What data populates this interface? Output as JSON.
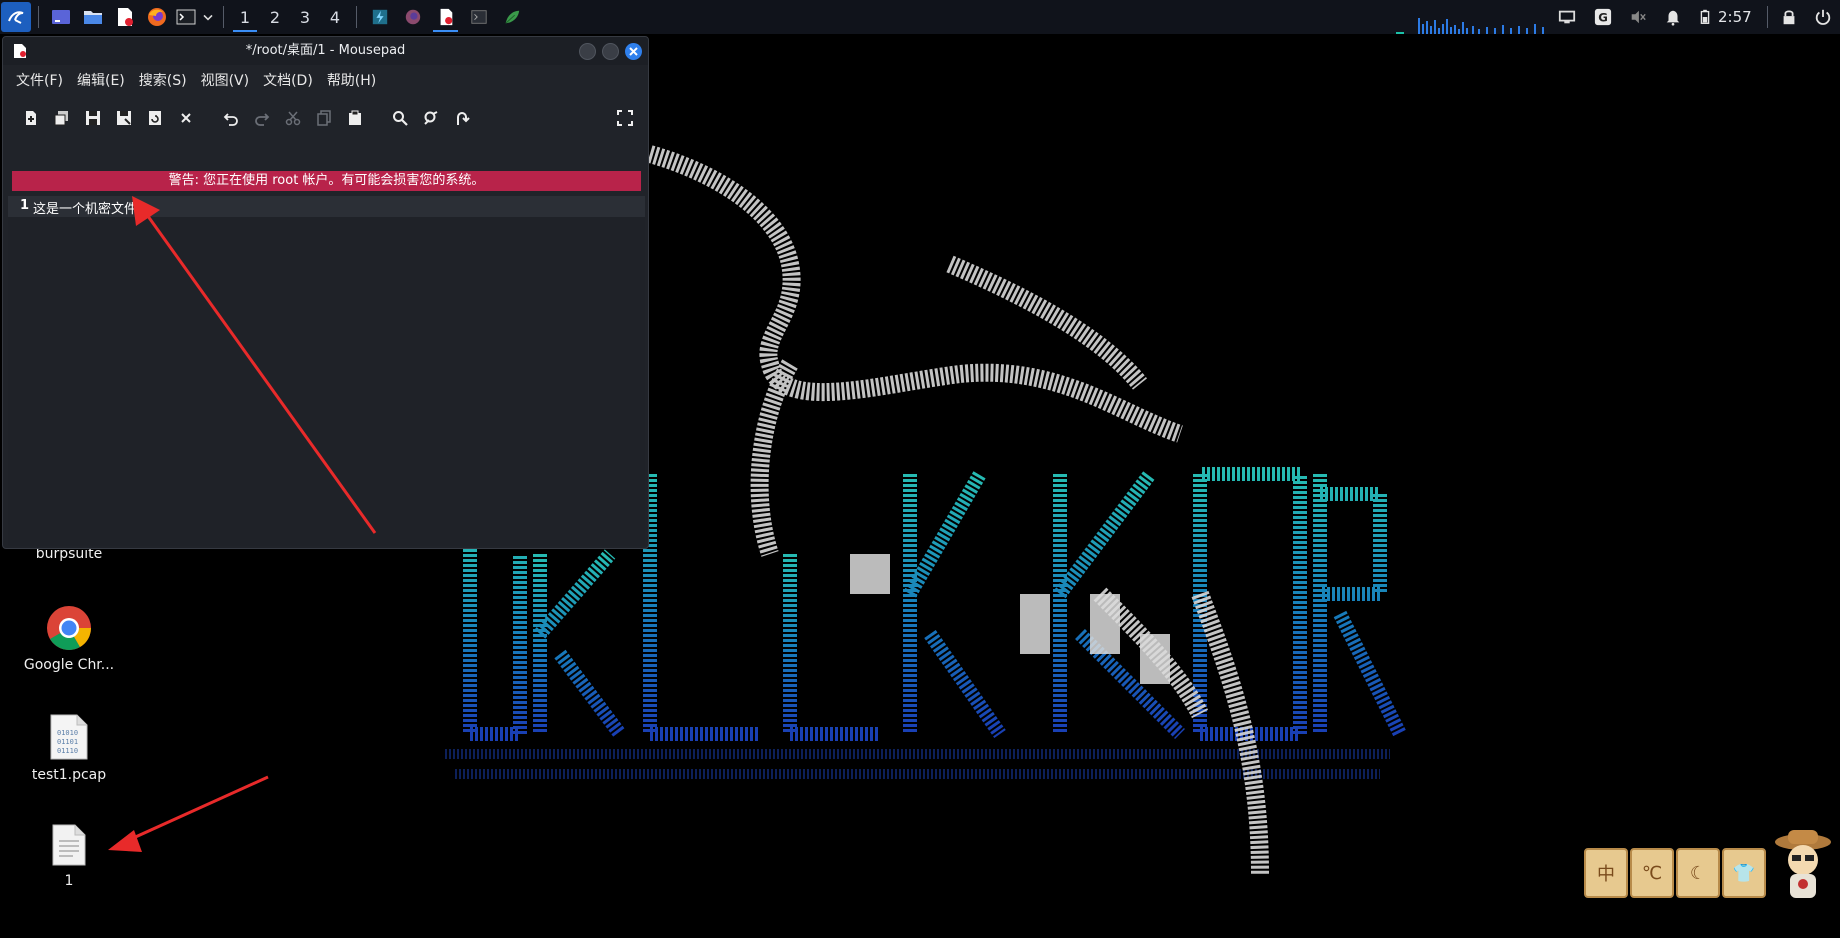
{
  "panel": {
    "workspaces": [
      "1",
      "2",
      "3",
      "4"
    ],
    "active_workspace": "1",
    "clock": "2:57",
    "accent": "#3a8ef6",
    "launchers": [
      "kali-menu-icon",
      "desktop-icon",
      "files-icon",
      "text-editor-icon",
      "firefox-icon",
      "terminal-icon"
    ],
    "tasks": [
      "burpsuite-task-icon",
      "firefox-task-icon",
      "mousepad-task-icon",
      "terminal-task-icon",
      "leaf-task-icon"
    ],
    "tray": [
      "screen-icon",
      "g-icon",
      "mute-icon",
      "bell-icon",
      "battery-icon",
      "lock-icon",
      "power-icon"
    ]
  },
  "window": {
    "title": "*/root/桌面/1 - Mousepad",
    "menus": [
      "文件(F)",
      "编辑(E)",
      "搜索(S)",
      "视图(V)",
      "文档(D)",
      "帮助(H)"
    ],
    "warning": "警告: 您正在使用 root 帐户。有可能会损害您的系统。",
    "warning_color": "#b8234a",
    "line_number": "1",
    "line_text": "这是一个机密文件"
  },
  "desktop": {
    "icons": [
      {
        "label": "burpsuite"
      },
      {
        "label": "Google Chr..."
      },
      {
        "label": "test1.pcap"
      },
      {
        "label": "1"
      }
    ],
    "pcap_glyph": [
      "01010",
      "01101",
      "01110"
    ]
  },
  "widgets": {
    "scrolls": [
      "中",
      "℃",
      "☾",
      "👕"
    ]
  }
}
